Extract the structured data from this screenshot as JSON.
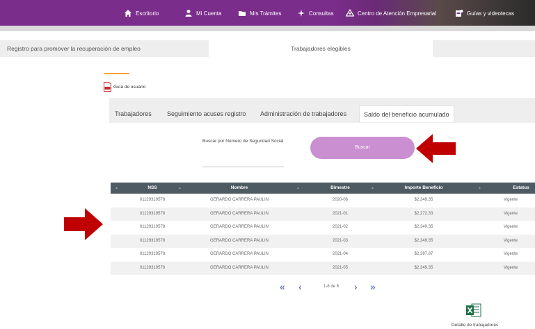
{
  "nav": {
    "items": [
      {
        "label": "Escritorio",
        "icon": "home-icon"
      },
      {
        "label": "Mi Cuenta",
        "icon": "user-icon"
      },
      {
        "label": "Mis Trámites",
        "icon": "folder-icon"
      },
      {
        "label": "Consultas",
        "icon": "sparkle-icon"
      },
      {
        "label": "Centro de Atención Empresarial",
        "icon": "people-icon"
      },
      {
        "label": "Guías y videotecas",
        "icon": "video-guide-icon"
      }
    ]
  },
  "main_tabs": [
    {
      "label": "Registro para promover la recuperación de empleo"
    },
    {
      "label": "Trabajadores elegibles"
    }
  ],
  "guide": {
    "label": "Guía de usuario",
    "icon": "pdf-icon"
  },
  "sub_tabs": [
    {
      "label": "Trabajadores"
    },
    {
      "label": "Seguimiento acuses registro"
    },
    {
      "label": "Administración de trabajadores"
    },
    {
      "label": "Saldo del beneficio acumulado"
    }
  ],
  "search": {
    "label": "Buscar por Número de Seguridad Social",
    "button": "Buscar"
  },
  "table": {
    "headers": [
      "NSS",
      "Nombre",
      "Bimestre",
      "Importe Beneficio",
      "Estatus"
    ],
    "rows": [
      [
        "01129319578",
        "GERARDO CARRERA PAULIN",
        "2020-06",
        "$2,349.35",
        "Vigente"
      ],
      [
        "01129319578",
        "GERARDO CARRERA PAULIN",
        "2021-01",
        "$2,272.33",
        "Vigente"
      ],
      [
        "01129319578",
        "GERARDO CARRERA PAULIN",
        "2021-02",
        "$2,349.35",
        "Vigente"
      ],
      [
        "01129319578",
        "GERARDO CARRERA PAULIN",
        "2021-03",
        "$2,349.35",
        "Vigente"
      ],
      [
        "01129319578",
        "GERARDO CARRERA PAULIN",
        "2021-04",
        "$2,387.87",
        "Vigente"
      ],
      [
        "01129319578",
        "GERARDO CARRERA PAULIN",
        "2021-05",
        "$2,349.35",
        "Vigente"
      ]
    ]
  },
  "pagination": {
    "text": "1-6 de 6"
  },
  "export": {
    "label": "Detalle de trabajadores",
    "icon": "excel-icon"
  },
  "colors": {
    "nav": "#7b2d8b",
    "button": "#c98fd0",
    "table_header": "#4e5b63",
    "arrow": "#c00000",
    "accent": "#f0a23a"
  }
}
